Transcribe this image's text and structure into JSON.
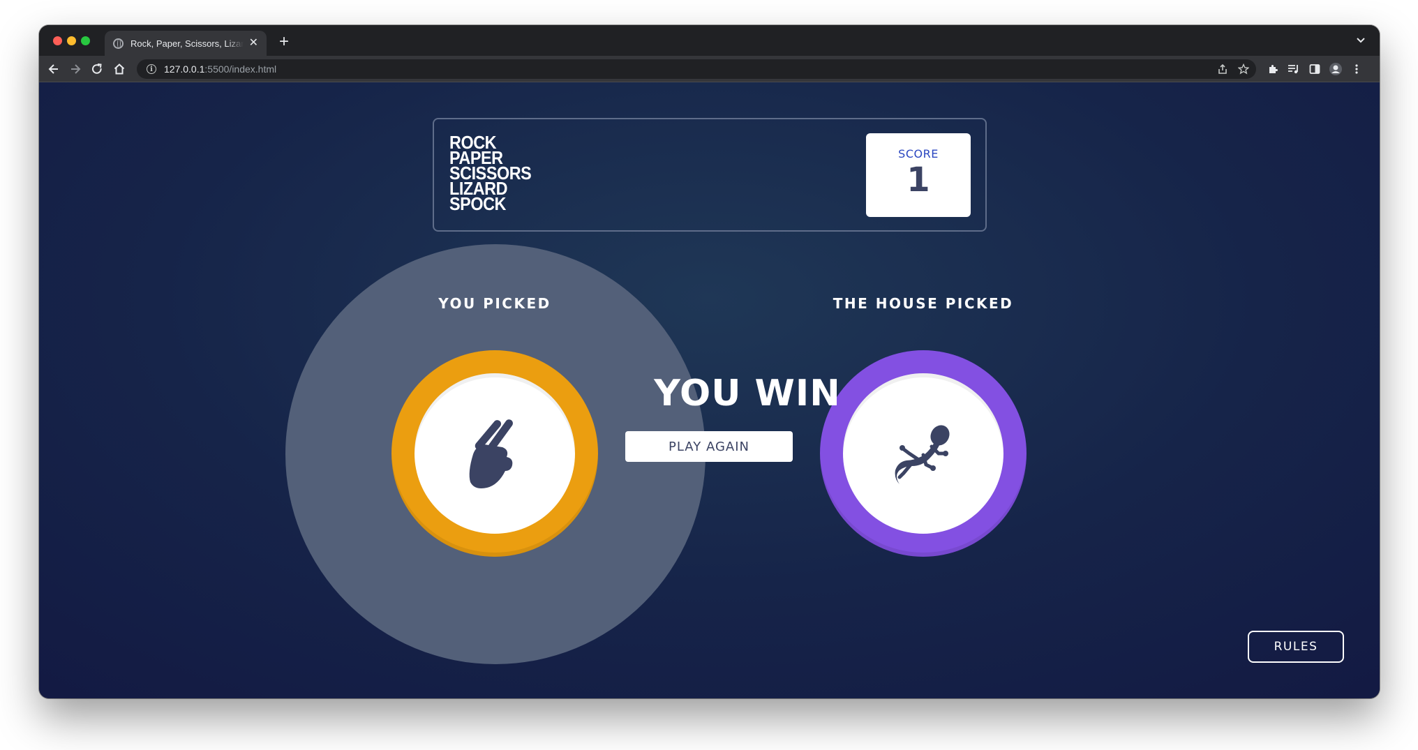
{
  "browser": {
    "tab_title": "Rock, Paper, Scissors, Lizard, Spock",
    "url_host": "127.0.0.1",
    "url_rest": ":5500/index.html"
  },
  "game": {
    "logo_lines": [
      "ROCK",
      "PAPER",
      "SCISSORS",
      "LIZARD",
      "SPOCK"
    ],
    "score_label": "SCORE",
    "score_value": "1",
    "you_picked_label": "YOU PICKED",
    "house_picked_label": "THE HOUSE PICKED",
    "player_pick": "scissors",
    "house_pick": "lizard",
    "result_text": "YOU WIN",
    "play_again_label": "PLAY AGAIN",
    "rules_label": "RULES"
  },
  "colors": {
    "scissors": "#eb9e10",
    "lizard": "#8350e2",
    "score_label": "#2a46c0",
    "icon_dark": "#3b4363"
  },
  "icons": [
    "scissors-hand-icon",
    "lizard-icon"
  ]
}
